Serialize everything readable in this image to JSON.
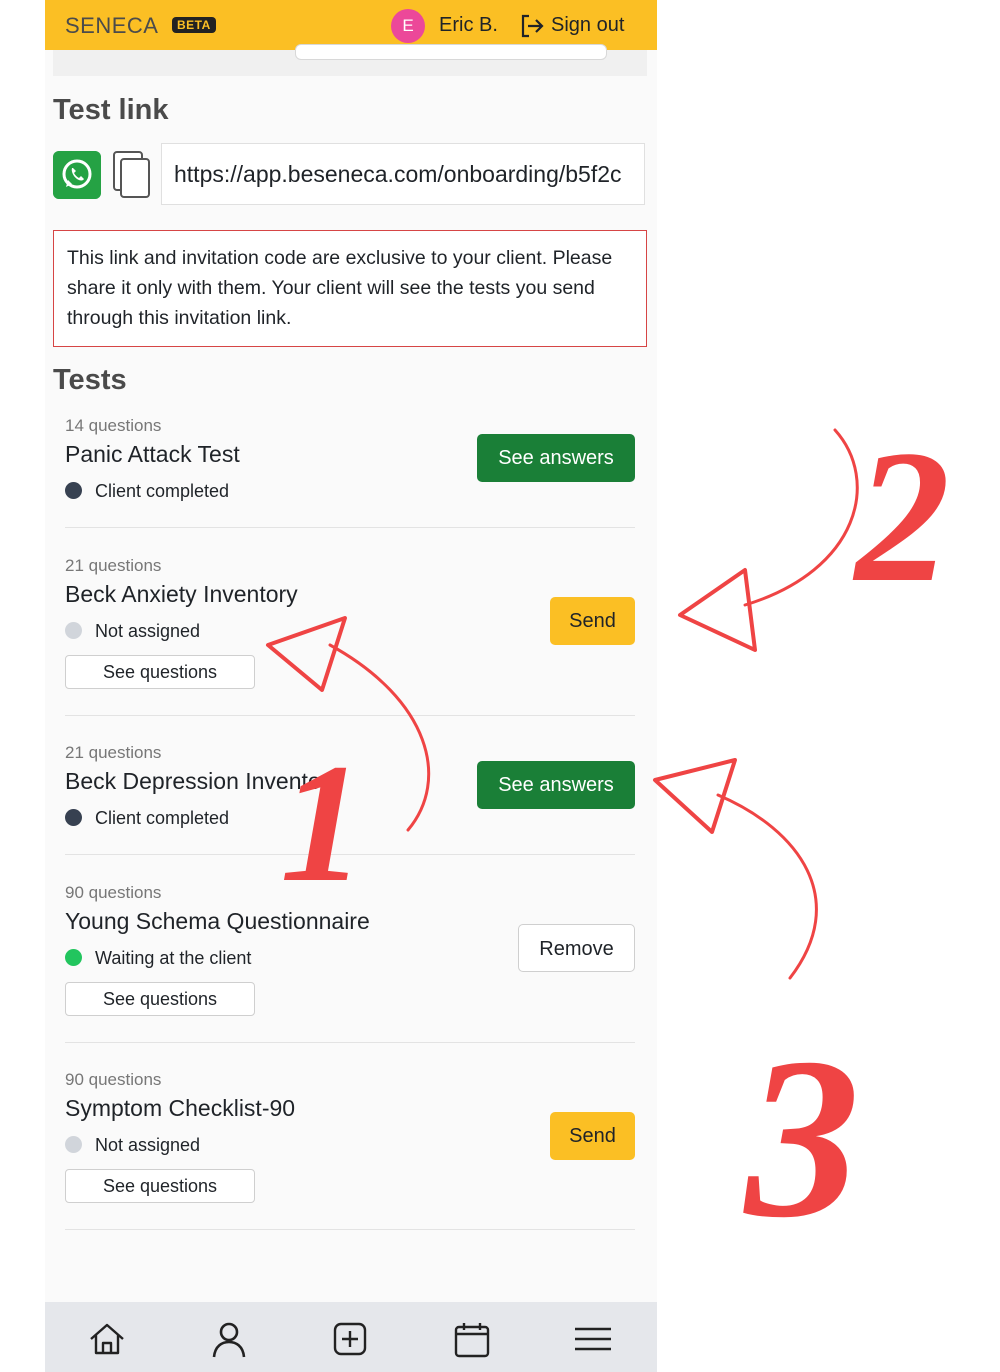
{
  "header": {
    "brand": "SENECA",
    "beta": "BETA",
    "avatar_initial": "E",
    "username": "Eric B.",
    "signout": "Sign out",
    "accent": "#fbbf24"
  },
  "test_link": {
    "heading": "Test link",
    "url": "https://app.beseneca.com/onboarding/b5f2c",
    "icons": [
      "whatsapp-icon",
      "copy-icon"
    ],
    "notice": "This link and invitation code are exclusive to your client. Please share it only with them. Your client will see the tests you send through this invitation link."
  },
  "tests": {
    "heading": "Tests",
    "items": [
      {
        "count": "14 questions",
        "name": "Panic Attack Test",
        "status": "Client completed",
        "action": "See answers"
      },
      {
        "count": "21 questions",
        "name": "Beck Anxiety Inventory",
        "status": "Not assigned",
        "see_questions": "See questions",
        "action": "Send"
      },
      {
        "count": "21 questions",
        "name": "Beck Depression Inventory",
        "status": "Client completed",
        "action": "See answers"
      },
      {
        "count": "90 questions",
        "name": "Young Schema Questionnaire",
        "status": "Waiting at the client",
        "see_questions": "See questions",
        "action": "Remove"
      },
      {
        "count": "90 questions",
        "name": "Symptom Checklist-90",
        "status": "Not assigned",
        "see_questions": "See questions",
        "action": "Send"
      }
    ]
  },
  "bottom_nav": [
    "home-icon",
    "user-icon",
    "plus-square-icon",
    "calendar-icon",
    "menu-icon"
  ],
  "annotations": {
    "numbers": [
      "1",
      "2",
      "3"
    ],
    "color": "#ef4444"
  }
}
